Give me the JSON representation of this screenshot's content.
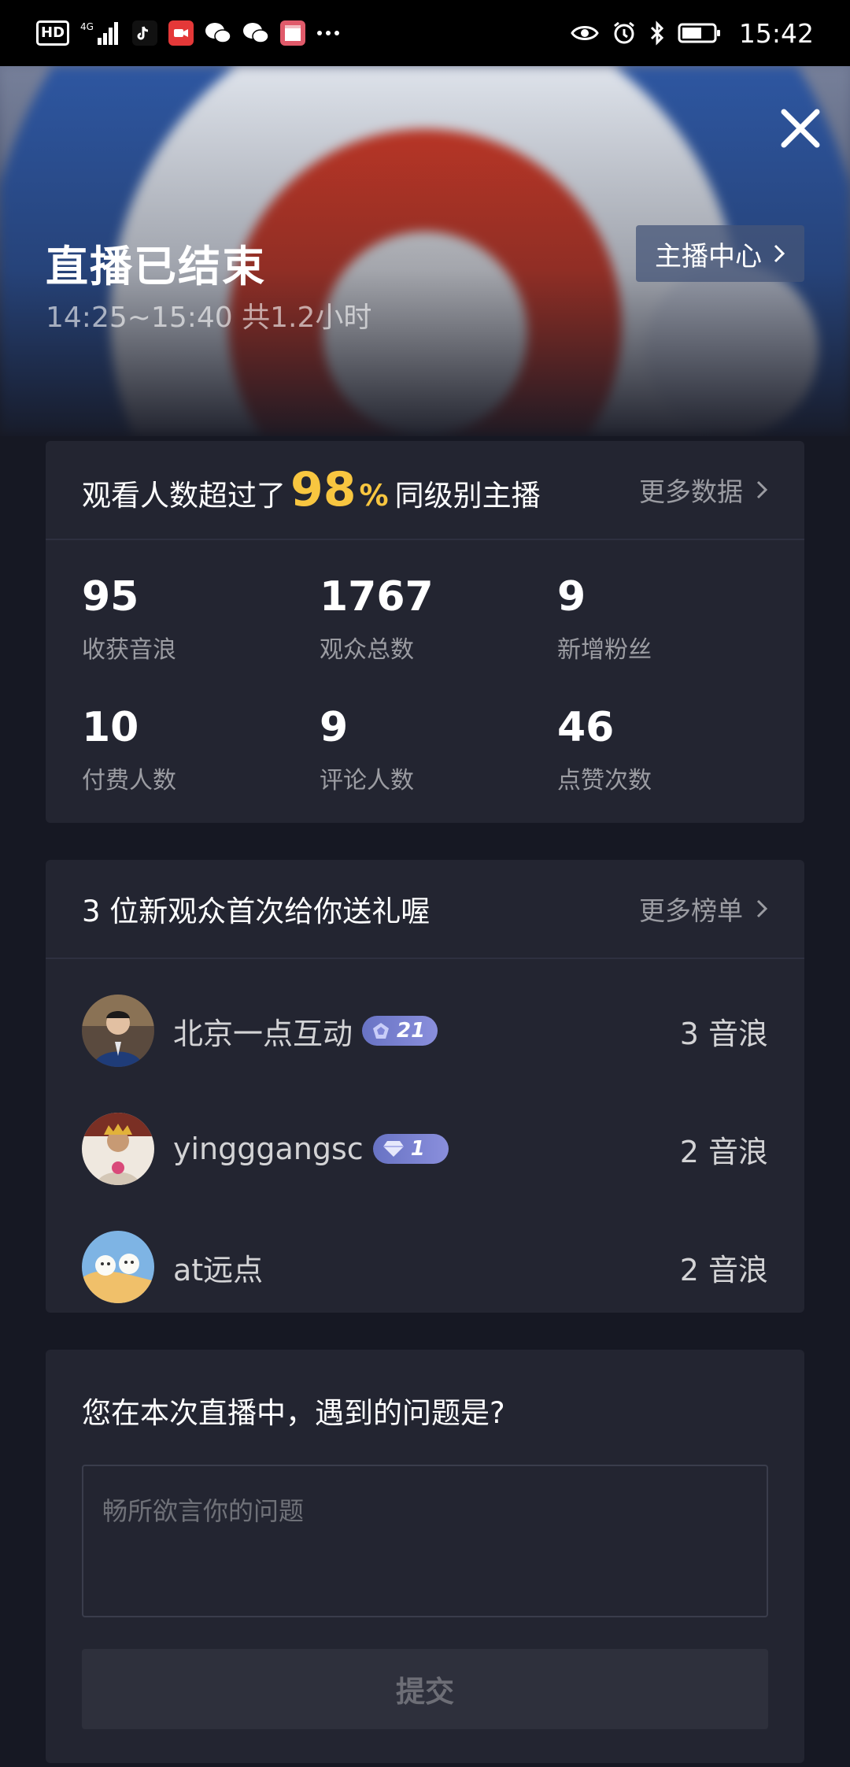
{
  "status_bar": {
    "time": "15:42",
    "network": "4G",
    "left_icons": [
      "hd-icon",
      "signal-icon",
      "tiktok-icon",
      "video-app-icon",
      "wechat-icon",
      "wechat-icon",
      "calendar-app-icon",
      "more-icon"
    ],
    "right_icons": [
      "eye-icon",
      "alarm-icon",
      "bluetooth-icon",
      "battery-icon"
    ]
  },
  "hero": {
    "title": "直播已结束",
    "subtitle": "14:25~15:40 共1.2小时",
    "center_button_label": "主播中心"
  },
  "stats_card": {
    "headline_prefix": "观看人数超过了",
    "headline_percent_value": "98",
    "headline_percent_sign": "%",
    "headline_suffix": "同级别主播",
    "more_label": "更多数据",
    "stats": [
      {
        "value": "95",
        "label": "收获音浪"
      },
      {
        "value": "1767",
        "label": "观众总数"
      },
      {
        "value": "9",
        "label": "新增粉丝"
      },
      {
        "value": "10",
        "label": "付费人数"
      },
      {
        "value": "9",
        "label": "评论人数"
      },
      {
        "value": "46",
        "label": "点赞次数"
      }
    ]
  },
  "gift_card": {
    "title": "3 位新观众首次给你送礼喔",
    "more_label": "更多榜单",
    "viewers": [
      {
        "name": "北京一点互动",
        "level": "21",
        "amount": "3 音浪"
      },
      {
        "name": "yingggangsc",
        "level": "1",
        "amount": "2 音浪"
      },
      {
        "name": "at远点",
        "level": "",
        "amount": "2 音浪"
      }
    ]
  },
  "feedback_card": {
    "question": "您在本次直播中，遇到的问题是?",
    "placeholder": "畅所欲言你的问题",
    "submit_label": "提交"
  },
  "colors": {
    "background": "#161823",
    "card": "#232531",
    "accent_yellow": "#f8c640",
    "badge": "#7a82d4"
  }
}
